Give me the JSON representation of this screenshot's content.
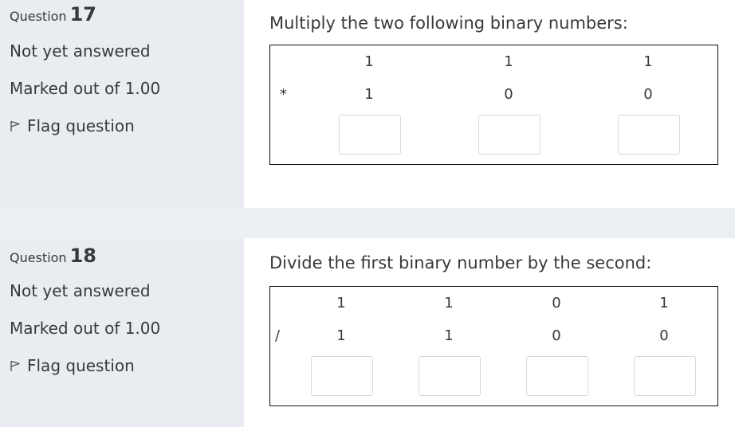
{
  "questions": [
    {
      "label": "Question",
      "number": "17",
      "state": "Not yet answered",
      "grade": "Marked out of 1.00",
      "flag": "Flag question",
      "prompt": "Multiply the two following binary numbers:",
      "row1": [
        "1",
        "1",
        "1"
      ],
      "operator": "*",
      "row2": [
        "1",
        "0",
        "0"
      ],
      "answers": [
        "",
        "",
        ""
      ]
    },
    {
      "label": "Question",
      "number": "18",
      "state": "Not yet answered",
      "grade": "Marked out of 1.00",
      "flag": "Flag question",
      "prompt": "Divide the first binary number by the second:",
      "row1": [
        "1",
        "1",
        "0",
        "1"
      ],
      "operator": "/",
      "row2": [
        "1",
        "1",
        "0",
        "0"
      ],
      "answers": [
        "",
        "",
        "",
        ""
      ]
    }
  ],
  "icons": {
    "flag": "flag-icon"
  }
}
